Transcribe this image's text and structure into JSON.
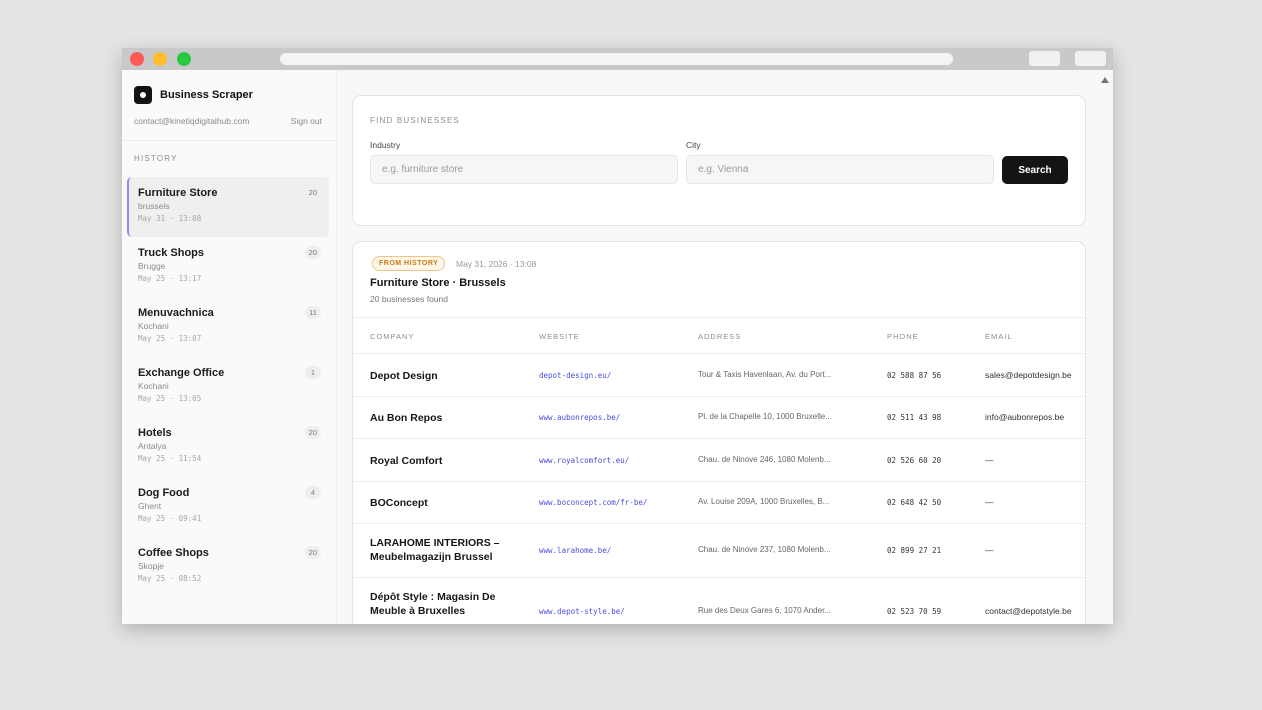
{
  "app": {
    "name": "Business Scraper",
    "account_email": "contact@kinetiqdigitalhub.com",
    "sign_out_label": "Sign out"
  },
  "sidebar": {
    "history_label": "HISTORY",
    "items": [
      {
        "title": "Furniture Store",
        "city": "brussels",
        "time": "May 31 · 13:08",
        "count": "20",
        "active": true
      },
      {
        "title": "Truck Shops",
        "city": "Brugge",
        "time": "May 25 · 13:17",
        "count": "20"
      },
      {
        "title": "Menuvachnica",
        "city": "Kochani",
        "time": "May 25 · 13:07",
        "count": "11"
      },
      {
        "title": "Exchange Office",
        "city": "Kochani",
        "time": "May 25 · 13:05",
        "count": "1"
      },
      {
        "title": "Hotels",
        "city": "Antalya",
        "time": "May 25 · 11:54",
        "count": "20"
      },
      {
        "title": "Dog Food",
        "city": "Ghent",
        "time": "May 25 · 09:41",
        "count": "4"
      },
      {
        "title": "Coffee Shops",
        "city": "Skopje",
        "time": "May 25 · 08:52",
        "count": "20"
      }
    ]
  },
  "search": {
    "section_title": "FIND BUSINESSES",
    "industry_label": "Industry",
    "industry_placeholder": "e.g. furniture store",
    "city_label": "City",
    "city_placeholder": "e.g. Vienna",
    "button_label": "Search"
  },
  "results": {
    "badge": "FROM HISTORY",
    "date": "May 31, 2026 · 13:08",
    "title": "Furniture Store · Brussels",
    "subtitle": "20 businesses found",
    "columns": {
      "company": "COMPANY",
      "website": "WEBSITE",
      "address": "ADDRESS",
      "phone": "PHONE",
      "email": "EMAIL"
    },
    "rows": [
      {
        "company": "Depot Design",
        "website": "depot-design.eu/",
        "address": "Tour & Taxis Havenlaan, Av. du Port...",
        "phone": "02 588 87 56",
        "email": "sales@depotdesign.be"
      },
      {
        "company": "Au Bon Repos",
        "website": "www.aubonrepos.be/",
        "address": "Pl. de la Chapelle 10, 1000 Bruxelle...",
        "phone": "02 511 43 98",
        "email": "info@aubonrepos.be"
      },
      {
        "company": "Royal Comfort",
        "website": "www.royalcomfort.eu/",
        "address": "Chau. de Ninove 246, 1080 Molenb...",
        "phone": "02 526 60 20",
        "email": "—"
      },
      {
        "company": "BOConcept",
        "website": "www.boconcept.com/fr-be/",
        "address": "Av. Louise 209A, 1000 Bruxelles, B...",
        "phone": "02 648 42 50",
        "email": "—"
      },
      {
        "company": "LARAHOME INTERIORS – Meubelmagazijn Brussel",
        "website": "www.larahome.be/",
        "address": "Chau. de Ninove 237, 1080 Molenb...",
        "phone": "02 899 27 21",
        "email": "—"
      },
      {
        "company": "Dépôt Style : Magasin De Meuble à Bruxelles",
        "website": "www.depot-style.be/",
        "address": "Rue des Deux Gares 6, 1070 Ander...",
        "phone": "02 523 70 59",
        "email": "contact@depotstyle.be"
      }
    ]
  },
  "colors": {
    "accent": "#4a4de0",
    "active_border": "#8b8ff2",
    "badge": "#c77a12",
    "primary_button": "#141414"
  }
}
